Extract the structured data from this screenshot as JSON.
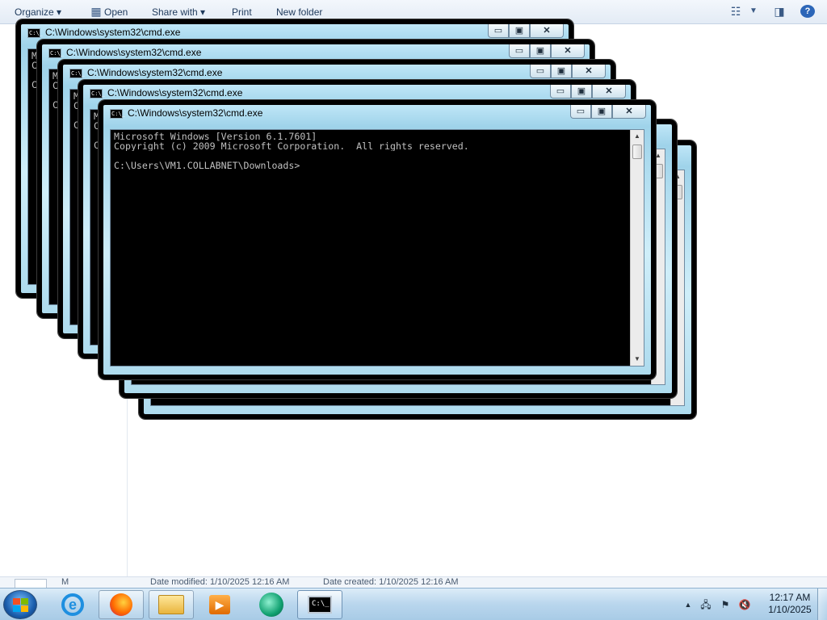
{
  "explorer": {
    "toolbar": {
      "organize": "Organize ▾",
      "open": "Open",
      "share_with": "Share with ▾",
      "print": "Print",
      "new_folder": "New folder"
    },
    "details": {
      "name": "M",
      "modified": "Date modified: 1/10/2025 12:16 AM",
      "created": "Date created: 1/10/2025 12:16 AM"
    }
  },
  "console": {
    "title": "C:\\Windows\\system32\\cmd.exe",
    "line1": "Microsoft Windows [Version 6.1.7601]",
    "line2": "Copyright (c) 2009 Microsoft Corporation.  All rights reserved.",
    "line3": "",
    "line4": "C:\\Users\\VM1.COLLABNET\\Downloads>",
    "partial_line1": "Mi",
    "partial_line2": "Co",
    "partial_line4": "C:",
    "icon_label": "C:\\_",
    "min_glyph": "▭",
    "max_glyph": "▣",
    "close_glyph": "✕"
  },
  "taskbar": {
    "apps": [
      {
        "name": "Internet Explorer",
        "icon": "ie-icon",
        "glyph": "e"
      },
      {
        "name": "Firefox",
        "icon": "firefox-icon"
      },
      {
        "name": "Windows Explorer",
        "icon": "folder-icon"
      },
      {
        "name": "Windows Media Player",
        "icon": "media-player-icon",
        "glyph": "▶"
      },
      {
        "name": "App",
        "icon": "circle-app-icon"
      },
      {
        "name": "Command Prompt",
        "icon": "cmd-icon",
        "glyph": "C:\\_"
      }
    ],
    "tray": {
      "chevron": "▲",
      "clock_time": "12:17 AM",
      "clock_date": "1/10/2025"
    }
  },
  "colors": {
    "console_bg": "#000000",
    "console_text": "#c0c0c0",
    "window_frame": "#a8d8ee"
  }
}
